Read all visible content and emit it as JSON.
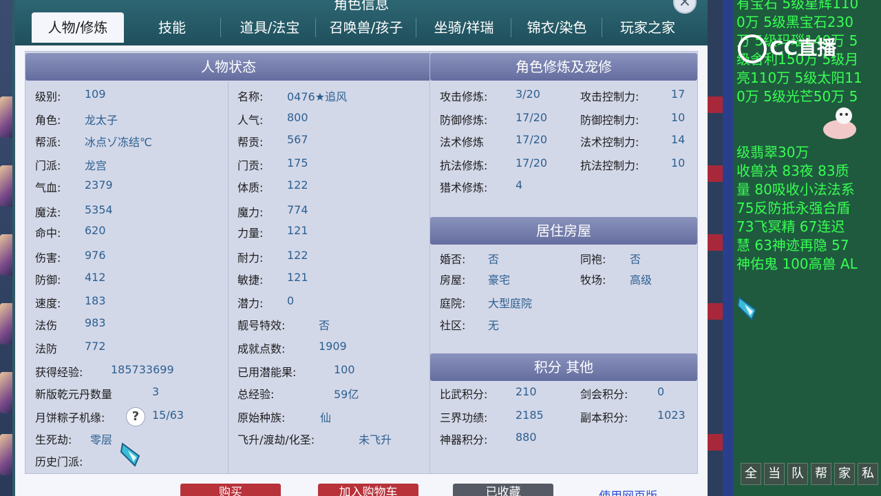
{
  "dialog": {
    "title": "角色信息",
    "close": "×"
  },
  "tabs": [
    {
      "label": "人物/修炼"
    },
    {
      "label": "技能"
    },
    {
      "label": "道具/法宝"
    },
    {
      "label": "召唤兽/孩子"
    },
    {
      "label": "坐骑/祥瑞"
    },
    {
      "label": "锦衣/染色"
    },
    {
      "label": "玩家之家"
    }
  ],
  "status": {
    "header": "人物状态",
    "left": [
      {
        "k": "级别:",
        "v": "109"
      },
      {
        "k": "角色:",
        "v": "龙太子"
      },
      {
        "k": "帮派:",
        "v": "冰点ゾ冻结℃"
      },
      {
        "k": "门派:",
        "v": "龙宫"
      },
      {
        "k": "气血:",
        "v": "2379"
      },
      {
        "k": "魔法:",
        "v": "5354"
      },
      {
        "k": "命中:",
        "v": "620"
      },
      {
        "k": "伤害:",
        "v": "976"
      },
      {
        "k": "防御:",
        "v": "412"
      },
      {
        "k": "速度:",
        "v": "183"
      },
      {
        "k": "法伤",
        "v": "983"
      },
      {
        "k": "法防",
        "v": "772"
      }
    ],
    "right": [
      {
        "k": "名称:",
        "v": "0476★追风"
      },
      {
        "k": "人气:",
        "v": "800"
      },
      {
        "k": "帮贡:",
        "v": "567"
      },
      {
        "k": "门贡:",
        "v": "175"
      },
      {
        "k": "体质:",
        "v": "122"
      },
      {
        "k": "魔力:",
        "v": "774"
      },
      {
        "k": "力量:",
        "v": "121"
      },
      {
        "k": "耐力:",
        "v": "122"
      },
      {
        "k": "敏捷:",
        "v": "121"
      },
      {
        "k": "潜力:",
        "v": "0"
      },
      {
        "k": "靓号特效:",
        "v": "否"
      },
      {
        "k": "成就点数:",
        "v": "1909"
      }
    ],
    "bottom": [
      {
        "k": "获得经验:",
        "v": "185733699",
        "k2": "已用潜能果:",
        "v2": "100"
      },
      {
        "k": "新版乾元丹数量",
        "v": "3",
        "k2": "总经验:",
        "v2": "59亿"
      },
      {
        "k": "月饼粽子机缘:",
        "v": "15/63",
        "k2": "原始种族:",
        "v2": "仙"
      },
      {
        "k": "生死劫:",
        "v": "零层",
        "k2": "飞升/渡劫/化圣:",
        "v2": "未飞升"
      },
      {
        "k": "历史门派:",
        "v": ""
      }
    ],
    "help": "?"
  },
  "cultivation": {
    "header": "角色修炼及宠修",
    "rows": [
      {
        "k": "攻击修炼:",
        "v": "3/20",
        "k2": "攻击控制力:",
        "v2": "17"
      },
      {
        "k": "防御修炼:",
        "v": "17/20",
        "k2": "防御控制力:",
        "v2": "10"
      },
      {
        "k": "法术修炼",
        "v": "17/20",
        "k2": "法术控制力:",
        "v2": "14"
      },
      {
        "k": "抗法修炼:",
        "v": "17/20",
        "k2": "抗法控制力:",
        "v2": "10"
      },
      {
        "k": "猎术修炼:",
        "v": "4",
        "k2": "",
        "v2": ""
      }
    ]
  },
  "housing": {
    "header": "居住房屋",
    "rows": [
      {
        "k": "婚否:",
        "v": "否",
        "k2": "同袍:",
        "v2": "否"
      },
      {
        "k": "房屋:",
        "v": "豪宅",
        "k2": "牧场:",
        "v2": "高级"
      },
      {
        "k": "庭院:",
        "v": "大型庭院",
        "k2": "",
        "v2": ""
      },
      {
        "k": "社区:",
        "v": "无",
        "k2": "",
        "v2": ""
      }
    ]
  },
  "points": {
    "header": "积分 其他",
    "rows": [
      {
        "k": "比武积分:",
        "v": "210",
        "k2": "剑会积分:",
        "v2": "0"
      },
      {
        "k": "三界功绩:",
        "v": "2185",
        "k2": "副本积分:",
        "v2": "1023"
      },
      {
        "k": "神器积分:",
        "v": "880",
        "k2": "",
        "v2": ""
      }
    ]
  },
  "footer": {
    "buy": "购买",
    "cart": "加入购物车",
    "fav": "已收藏",
    "link": "使用网页版"
  },
  "chat": {
    "logo": "CC直播",
    "lines": [
      "有宝石 5级星辉110",
      "0万 5级黑宝石230",
      "万 5级玛瑙140万 5",
      "级舍利150万 5级月",
      "亮110万 5级太阳11",
      "0万 5级光芒50万 5",
      "",
      "",
      "级翡翠30万",
      "收兽决 83夜 83质",
      "量 80吸收小法法系",
      " 75反防抵永强合盾",
      " 73飞冥精 67连迟",
      "慧 63神迹再隐 57",
      "神佑鬼 100高兽 AL"
    ],
    "channels": [
      "全",
      "当",
      "队",
      "帮",
      "家",
      "私"
    ]
  },
  "colors": {
    "accent": "#2c5f8e",
    "header": "#646d9e",
    "chat_text": "#38ff52"
  }
}
